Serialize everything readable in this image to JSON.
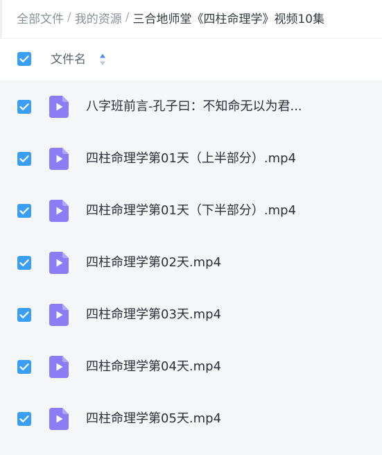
{
  "breadcrumb": {
    "root": "全部文件",
    "parent": "我的资源",
    "current": "三合地师堂《四柱命理学》视频10集",
    "separator": "/"
  },
  "header": {
    "select_all_checked": true,
    "column_label": "文件名"
  },
  "files": [
    {
      "name": "八字班前言-孔子曰：不知命无以为君...",
      "checked": true,
      "icon": "video-file-icon"
    },
    {
      "name": "四柱命理学第01天（上半部分）.mp4",
      "checked": true,
      "icon": "video-file-icon"
    },
    {
      "name": "四柱命理学第01天（下半部分）.mp4",
      "checked": true,
      "icon": "video-file-icon"
    },
    {
      "name": "四柱命理学第02天.mp4",
      "checked": true,
      "icon": "video-file-icon"
    },
    {
      "name": "四柱命理学第03天.mp4",
      "checked": true,
      "icon": "video-file-icon"
    },
    {
      "name": "四柱命理学第04天.mp4",
      "checked": true,
      "icon": "video-file-icon"
    },
    {
      "name": "四柱命理学第05天.mp4",
      "checked": true,
      "icon": "video-file-icon"
    }
  ],
  "colors": {
    "checkbox": "#3a9ef5",
    "video_icon": "#8c7df5",
    "list_background": "#f5f6f8"
  }
}
